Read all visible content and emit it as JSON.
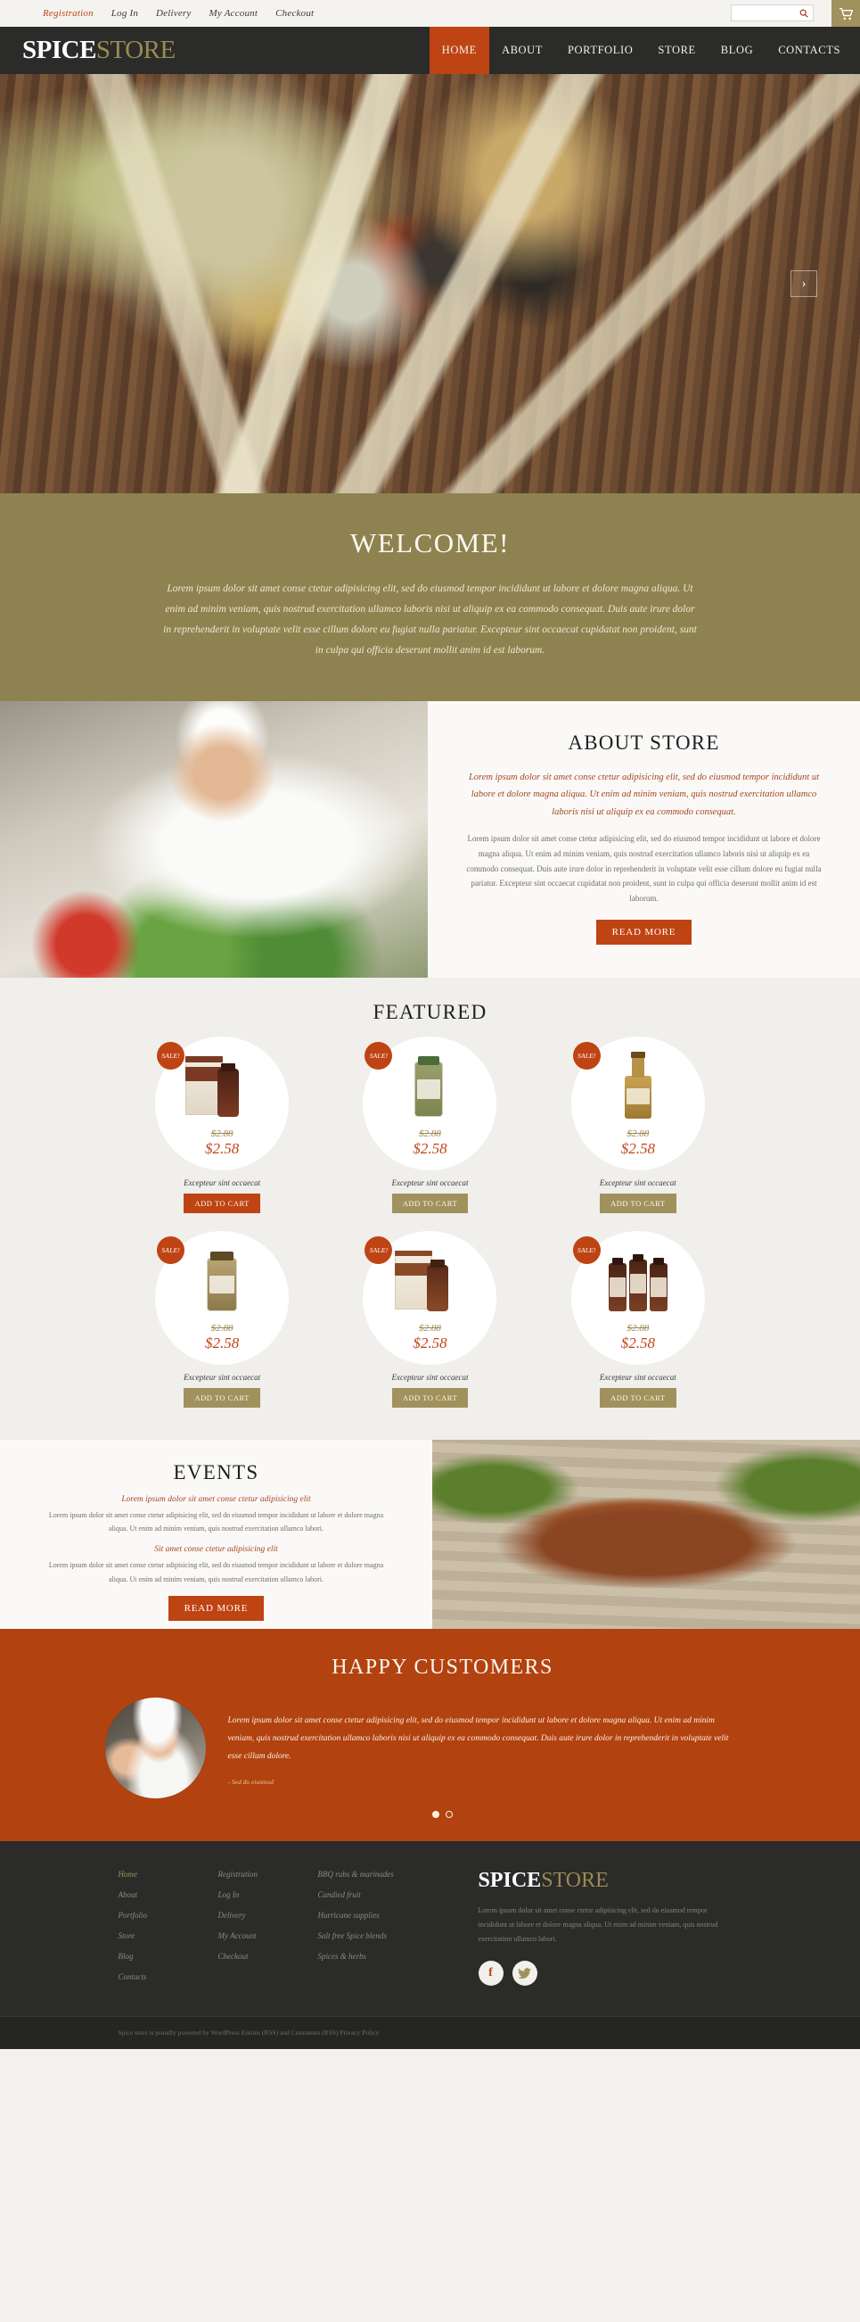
{
  "topbar": {
    "links": [
      {
        "label": "Registration",
        "active": true
      },
      {
        "label": "Log In",
        "active": false
      },
      {
        "label": "Delivery",
        "active": false
      },
      {
        "label": "My Account",
        "active": false
      },
      {
        "label": "Checkout",
        "active": false
      }
    ],
    "search_value": "",
    "search_placeholder": "",
    "search_icon": "search-icon",
    "cart_icon": "shopping-cart-icon"
  },
  "header": {
    "logo_bold": "SPICE",
    "logo_light": "STORE",
    "nav": [
      {
        "label": "HOME",
        "active": true
      },
      {
        "label": "ABOUT",
        "active": false
      },
      {
        "label": "PORTFOLIO",
        "active": false
      },
      {
        "label": "STORE",
        "active": false
      },
      {
        "label": "BLOG",
        "active": false
      },
      {
        "label": "CONTACTS",
        "active": false
      }
    ]
  },
  "hero": {
    "next_icon": "chevron-right-icon",
    "next_label": "›"
  },
  "welcome": {
    "title": "WELCOME!",
    "body": "Lorem ipsum dolor sit amet conse ctetur adipisicing elit, sed do eiusmod tempor incididunt ut labore et dolore magna aliqua. Ut enim ad minim veniam, quis nostrud exercitation ullamco laboris nisi ut aliquip ex ea commodo consequat. Duis aute irure dolor in reprehenderit in voluptate velit esse cillum dolore eu fugiat nulla pariatur. Excepteur sint occaecat cupidatat non proident, sunt in culpa qui officia deserunt mollit anim id est laborum."
  },
  "about": {
    "title": "ABOUT STORE",
    "lead": "Lorem ipsum dolor sit amet conse ctetur adipisicing elit, sed do eiusmod tempor incididunt ut labore et dolore magna aliqua. Ut enim ad minim veniam, quis nostrud exercitation ullamco laboris nisi ut aliquip ex ea commodo consequat.",
    "body": "Lorem ipsum dolor sit amet conse ctetur adipisicing elit, sed do eiusmod tempor incididunt ut labore et dolore magna aliqua. Ut enim ad minim veniam, quis nostrud exercitation ullamco laboris nisi ut aliquip ex ea commodo consequat. Duis aute irure dolor in reprehenderit in voluptate velit esse cillum dolore eu fugiat nulla pariatur. Excepteur sint occaecat cupidatat non proident, sunt in culpa qui officia deserunt mollit anim id est laborum.",
    "button": "READ MORE",
    "image_alt": "smiling-chef-with-vegetables"
  },
  "featured": {
    "title": "FEATURED",
    "sale_badge": "SALE!",
    "products": [
      {
        "caption": "Excepteur sint occaecat",
        "price_old": "$2.88",
        "price_new": "$2.58",
        "button": "ADD TO CART",
        "button_hot": true,
        "image_alt": "watkins-chocolate-extract"
      },
      {
        "caption": "Excepteur sint occaecat",
        "price_old": "$2.88",
        "price_new": "$2.58",
        "button": "ADD TO CART",
        "button_hot": false,
        "image_alt": "oregano-spice-jar"
      },
      {
        "caption": "Excepteur sint occaecat",
        "price_old": "$2.88",
        "price_new": "$2.58",
        "button": "ADD TO CART",
        "button_hot": false,
        "image_alt": "olive-oil-bottle"
      },
      {
        "caption": "Excepteur sint occaecat",
        "price_old": "$2.88",
        "price_new": "$2.58",
        "button": "ADD TO CART",
        "button_hot": false,
        "image_alt": "mixed-herbs-jar"
      },
      {
        "caption": "Excepteur sint occaecat",
        "price_old": "$2.88",
        "price_new": "$2.58",
        "button": "ADD TO CART",
        "button_hot": false,
        "image_alt": "watkins-cinnamon-extract"
      },
      {
        "caption": "Excepteur sint occaecat",
        "price_old": "$2.88",
        "price_new": "$2.58",
        "button": "ADD TO CART",
        "button_hot": false,
        "image_alt": "three-extract-bottles"
      }
    ]
  },
  "events": {
    "title": "EVENTS",
    "items": [
      {
        "heading": "Lorem ipsum dolor sit amet conse ctetur adipisicing elit",
        "body": "Lorem ipsum dolor sit amet conse ctetur adipisicing elit, sed do eiusmod tempor incididunt ut labore et dolore magna aliqua. Ut enim ad minim veniam, quis nostrud exercitation ullamco labori."
      },
      {
        "heading": "Sit amet conse ctetur adipisicing elit",
        "body": "Lorem ipsum dolor sit amet conse ctetur adipisicing elit, sed do eiusmod tempor incididunt ut labore et dolore magna aliqua. Ut enim ad minim veniam, quis nostrud exercitation ullamco labori."
      }
    ],
    "button": "READ MORE",
    "image_alt": "grilled-steak-with-rosemary"
  },
  "testimonials": {
    "title": "HAPPY CUSTOMERS",
    "quote": "Lorem ipsum dolor sit amet conse ctetur adipisicing elit, sed do eiusmod tempor incididunt ut labore et dolore magna aliqua. Ut enim ad minim veniam, quis nostrud exercitation ullamco laboris nisi ut aliquip ex ea commodo consequat. Duis aute irure dolor in reprehenderit in voluptate velit esse cillum dolore.",
    "author": "- Sed do eiusmod",
    "avatar_alt": "female-chef-ok-gesture",
    "dots": [
      {
        "active": true
      },
      {
        "active": false
      }
    ]
  },
  "footer": {
    "col1": [
      {
        "label": "Home",
        "active": true
      },
      {
        "label": "About",
        "active": false
      },
      {
        "label": "Portfolio",
        "active": false
      },
      {
        "label": "Store",
        "active": false
      },
      {
        "label": "Blog",
        "active": false
      },
      {
        "label": "Contacts",
        "active": false
      }
    ],
    "col2": [
      {
        "label": "Registration",
        "active": false
      },
      {
        "label": "Log In",
        "active": false
      },
      {
        "label": "Delivery",
        "active": false
      },
      {
        "label": "My Account",
        "active": false
      },
      {
        "label": "Checkout",
        "active": false
      }
    ],
    "col3": [
      {
        "label": "BBQ rubs & marinades",
        "active": false
      },
      {
        "label": "Candied fruit",
        "active": false
      },
      {
        "label": "Hurricane supplies",
        "active": false
      },
      {
        "label": "Salt free Spice blends",
        "active": false
      },
      {
        "label": "Spices & herbs",
        "active": false
      }
    ],
    "logo_bold": "SPICE",
    "logo_light": "STORE",
    "about": "Lorem ipsum dolor sit amet conse ctetur adipisicing elit, sed do eiusmod tempor incididunt ut labore et dolore magna aliqua. Ut enim ad minim veniam, quis nostrud exercitation ullamco labori.",
    "socials": [
      {
        "name": "facebook-icon",
        "glyph": "f"
      },
      {
        "name": "twitter-icon",
        "glyph": "ᵗ"
      }
    ],
    "copyright": "Spice store is proudly powered by WordPress Entries (RSS) and Comments (RSS) Privacy Policy"
  },
  "colors": {
    "accent_orange": "#bf4413",
    "accent_olive": "#a1915c",
    "dark": "#2b2b2a",
    "welcome_bg": "#8e8350",
    "testimonial_bg": "#b2420f"
  }
}
